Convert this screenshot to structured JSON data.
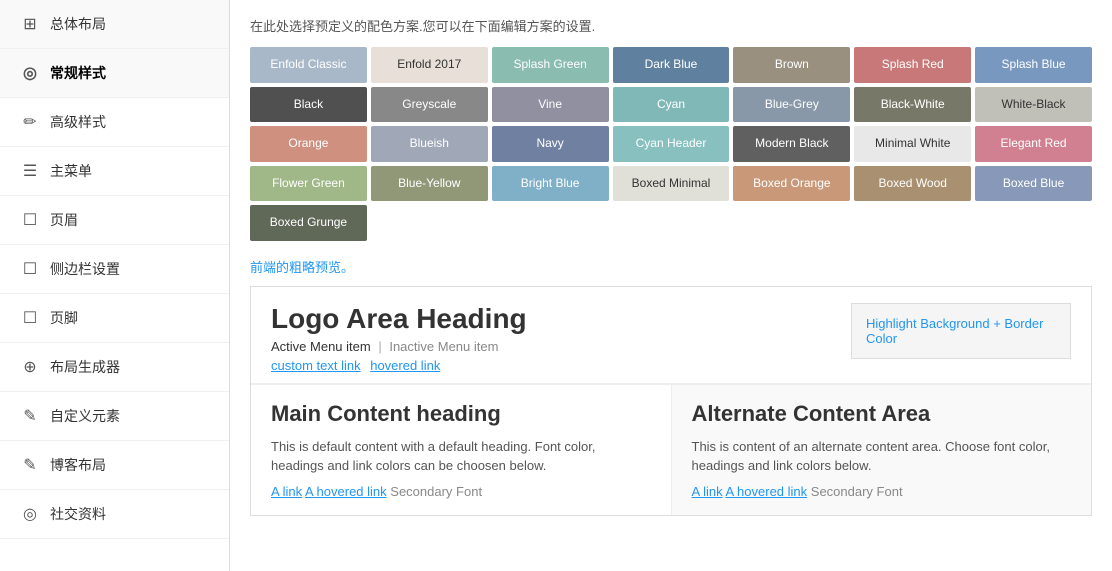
{
  "sidebar": {
    "items": [
      {
        "label": "总体布局",
        "icon": "⊞",
        "active": false
      },
      {
        "label": "常规样式",
        "icon": "◎",
        "active": true
      },
      {
        "label": "高级样式",
        "icon": "✏",
        "active": false
      },
      {
        "label": "主菜单",
        "icon": "☰",
        "active": false
      },
      {
        "label": "页眉",
        "icon": "☐",
        "active": false
      },
      {
        "label": "侧边栏设置",
        "icon": "☐",
        "active": false
      },
      {
        "label": "页脚",
        "icon": "☐",
        "active": false
      },
      {
        "label": "布局生成器",
        "icon": "⊕",
        "active": false
      },
      {
        "label": "自定义元素",
        "icon": "✎",
        "active": false
      },
      {
        "label": "博客布局",
        "icon": "✎",
        "active": false
      },
      {
        "label": "社交资料",
        "icon": "◎",
        "active": false
      }
    ]
  },
  "main": {
    "description": "在此处选择预定义的配色方案.您可以在下面编辑方案的设置.",
    "color_schemes": [
      {
        "label": "Enfold Classic",
        "bg": "#a8b8c8",
        "text_class": ""
      },
      {
        "label": "Enfold 2017",
        "bg": "#e8e0d8",
        "text_class": "dark-text"
      },
      {
        "label": "Splash Green",
        "bg": "#8bbcb0",
        "text_class": ""
      },
      {
        "label": "Dark Blue",
        "bg": "#6080a0",
        "text_class": ""
      },
      {
        "label": "Brown",
        "bg": "#9a9080",
        "text_class": ""
      },
      {
        "label": "Splash Red",
        "bg": "#c87878",
        "text_class": ""
      },
      {
        "label": "Splash Blue",
        "bg": "#7898c0",
        "text_class": ""
      },
      {
        "label": "Black",
        "bg": "#505050",
        "text_class": ""
      },
      {
        "label": "Greyscale",
        "bg": "#888888",
        "text_class": ""
      },
      {
        "label": "Vine",
        "bg": "#9090a0",
        "text_class": ""
      },
      {
        "label": "Cyan",
        "bg": "#80b8b8",
        "text_class": ""
      },
      {
        "label": "Blue-Grey",
        "bg": "#8898a8",
        "text_class": ""
      },
      {
        "label": "Black-White",
        "bg": "#787868",
        "text_class": ""
      },
      {
        "label": "White-Black",
        "bg": "#c0c0b8",
        "text_class": "dark-text"
      },
      {
        "label": "Orange",
        "bg": "#d09080",
        "text_class": ""
      },
      {
        "label": "Blueish",
        "bg": "#a0a8b8",
        "text_class": ""
      },
      {
        "label": "Navy",
        "bg": "#7080a0",
        "text_class": ""
      },
      {
        "label": "Cyan Header",
        "bg": "#88c0c0",
        "text_class": ""
      },
      {
        "label": "Modern Black",
        "bg": "#606060",
        "text_class": ""
      },
      {
        "label": "Minimal White",
        "bg": "#e8e8e8",
        "text_class": "dark-text"
      },
      {
        "label": "Elegant Red",
        "bg": "#d08090",
        "text_class": ""
      },
      {
        "label": "Flower Green",
        "bg": "#a0b888",
        "text_class": ""
      },
      {
        "label": "Blue-Yellow",
        "bg": "#909878",
        "text_class": ""
      },
      {
        "label": "Bright Blue",
        "bg": "#80b0c8",
        "text_class": ""
      },
      {
        "label": "Boxed Minimal",
        "bg": "#e0e0d8",
        "text_class": "dark-text"
      },
      {
        "label": "Boxed Orange",
        "bg": "#c89878",
        "text_class": ""
      },
      {
        "label": "Boxed Wood",
        "bg": "#a89070",
        "text_class": ""
      },
      {
        "label": "Boxed Blue",
        "bg": "#8898b8",
        "text_class": ""
      },
      {
        "label": "Boxed Grunge",
        "bg": "#606858",
        "text_class": ""
      }
    ],
    "preview_label": "前端的粗略预览。",
    "preview": {
      "logo_heading": "Logo Area Heading",
      "menu_active": "Active Menu item",
      "menu_separator": "|",
      "menu_inactive": "Inactive Menu item",
      "link_text": "custom text link",
      "hovered_link": "hovered link",
      "highlight_box_text": "Highlight Background + Border Color",
      "main_heading": "Main Content heading",
      "main_para1": "This is default content with a default heading. Font color, headings and link colors can be choosen below.",
      "main_link": "A link",
      "main_hovered_link": "A hovered link",
      "main_secondary": "Secondary Font",
      "alt_heading": "Alternate Content Area",
      "alt_para1": "This is content of an alternate content area. Choose font color, headings and link colors below.",
      "alt_link": "A link",
      "alt_hovered_link": "A hovered link",
      "alt_secondary": "Secondary Font"
    }
  }
}
